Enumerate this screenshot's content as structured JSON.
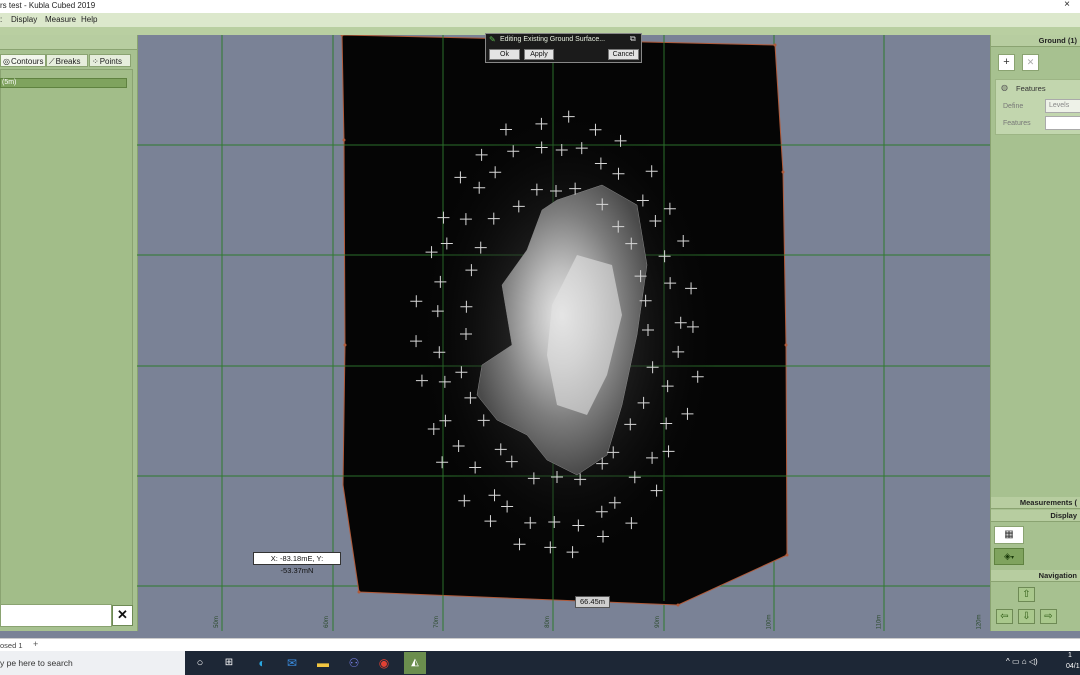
{
  "window": {
    "title": "rs test - Kubla Cubed 2019",
    "close_glyph": "×"
  },
  "menu": {
    "items": [
      ":",
      "Display",
      "Measure",
      "Help"
    ]
  },
  "left_panel": {
    "tabs": [
      {
        "label": "Contours",
        "icon": "contours-icon"
      },
      {
        "label": "Breaks",
        "icon": "breaks-icon"
      },
      {
        "label": "Points",
        "icon": "points-icon"
      }
    ],
    "list_item": "(5m)",
    "close_glyph": "✕"
  },
  "edit_dialog": {
    "title": "Editing Existing Ground Surface...",
    "ok_label": "Ok",
    "apply_label": "Apply",
    "cancel_label": "Cancel"
  },
  "right_panel": {
    "ground_header": "Ground (1)",
    "add_glyph": "+",
    "delete_glyph": "✕",
    "features_label": "Features",
    "define_label": "Define",
    "define_value": "Levels",
    "features_field_label": "Features",
    "measurements_header": "Measurements (",
    "display_header": "Display",
    "navigation_header": "Navigation",
    "nav": {
      "up": "⇧",
      "left": "⇦",
      "down": "⇩",
      "right": "⇨"
    }
  },
  "viewport": {
    "coord_readout": "X: -83.18mE, Y: -53.37mN",
    "distance_label": "66.45m",
    "axis_labels": [
      "50m",
      "60m",
      "70m",
      "80m",
      "90m",
      "100m",
      "110m",
      "120m",
      "130m"
    ]
  },
  "tabs_bar": {
    "doc_tab": "osed 1",
    "add_glyph": "+"
  },
  "taskbar": {
    "search_placeholder": "y pe here to search",
    "clock_time": "1",
    "clock_date": "04/1",
    "tray": "^  ▭  ⌂  ◁)"
  },
  "colors": {
    "panel_green": "#a7c190",
    "viewport_bg": "#7a8296",
    "grid_green": "#2f7a2f",
    "surface_black": "#050505"
  }
}
